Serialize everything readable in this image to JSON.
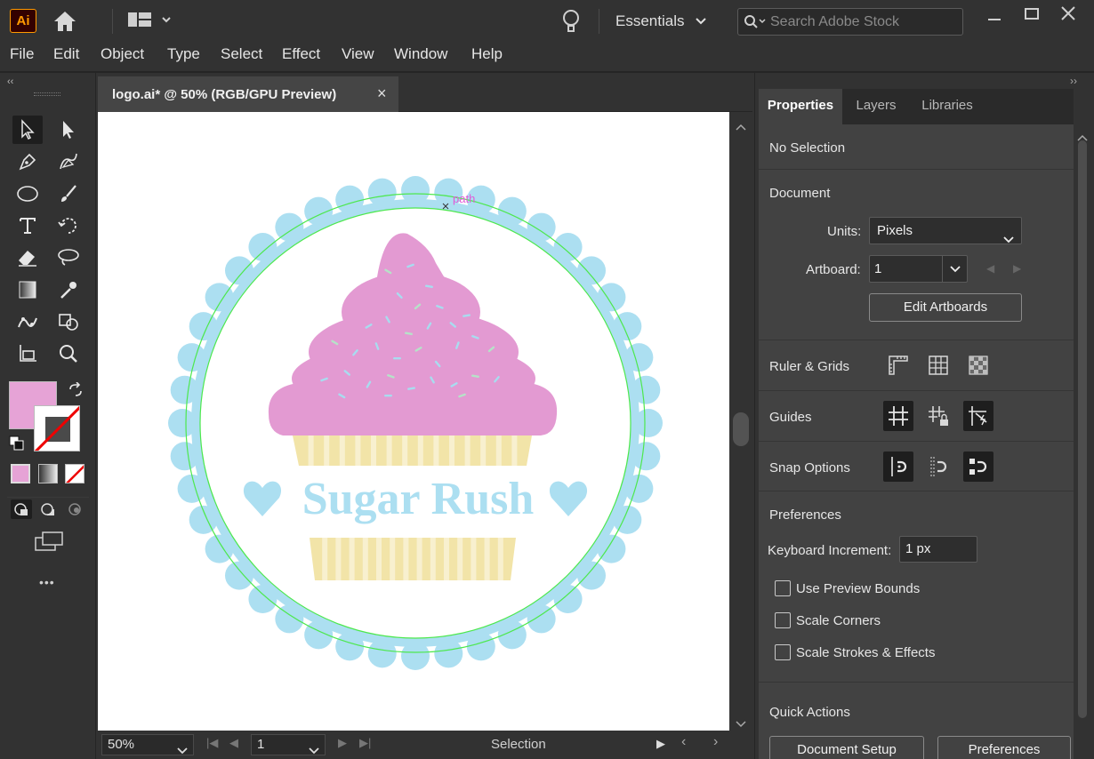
{
  "app": {
    "logo_text": "Ai",
    "workspace_label": "Essentials",
    "search_placeholder": "Search Adobe Stock"
  },
  "menu": [
    "File",
    "Edit",
    "Object",
    "Type",
    "Select",
    "Effect",
    "View",
    "Window",
    "Help"
  ],
  "document": {
    "tab_title": "logo.ai* @ 50% (RGB/GPU Preview)",
    "close_glyph": "×"
  },
  "artwork": {
    "title": "Sugar Rush",
    "hover_label": "path",
    "colors": {
      "ring": "#acdff1",
      "frosting": "#e39ad2",
      "wrapper": "#f2e4a8",
      "sprinkle_blue": "#a8dcef",
      "sprinkle_green": "#b6e2c8",
      "path_highlight": "#4de84d"
    }
  },
  "toolbar": {
    "fill_color": "#e6a3d6",
    "stroke_color": "#ffffff",
    "more_glyph": "•••"
  },
  "status": {
    "zoom": "50%",
    "artboard_number": "1",
    "current_tool": "Selection"
  },
  "properties_panel": {
    "tabs": [
      "Properties",
      "Layers",
      "Libraries"
    ],
    "selection_state": "No Selection",
    "document_header": "Document",
    "units_label": "Units:",
    "units_value": "Pixels",
    "artboard_label": "Artboard:",
    "artboard_value": "1",
    "edit_artboards_label": "Edit Artboards",
    "ruler_grids_label": "Ruler & Grids",
    "guides_label": "Guides",
    "snap_options_label": "Snap Options",
    "preferences_header": "Preferences",
    "keyboard_increment_label": "Keyboard Increment:",
    "keyboard_increment_value": "1 px",
    "checkboxes": [
      "Use Preview Bounds",
      "Scale Corners",
      "Scale Strokes & Effects"
    ],
    "quick_actions_header": "Quick Actions",
    "quick_action_buttons": [
      "Document Setup",
      "Preferences"
    ]
  }
}
